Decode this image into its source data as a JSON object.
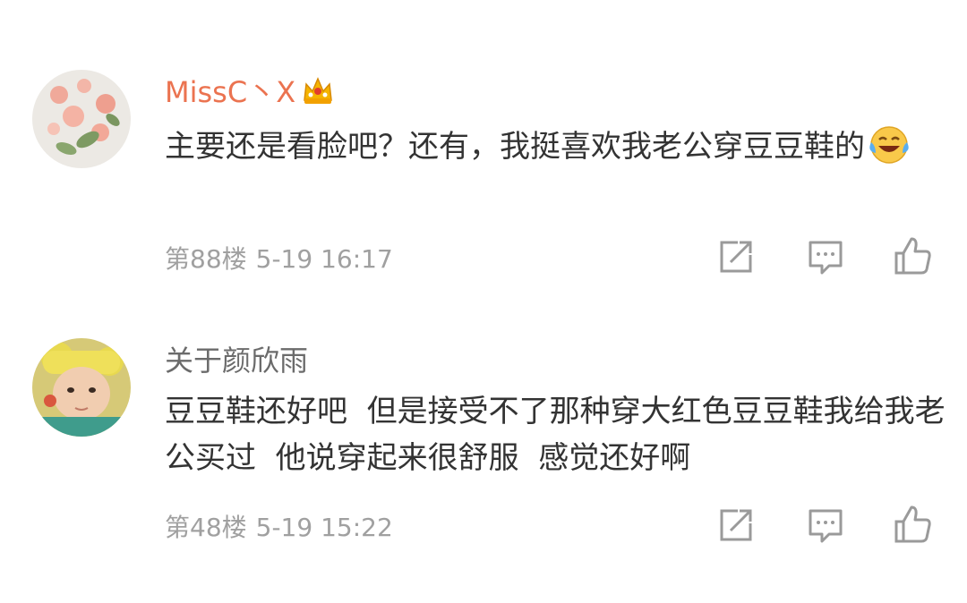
{
  "comments": [
    {
      "username": "MissC丶X",
      "text": "主要还是看脸吧？还有，我挺喜欢我老公穿豆豆鞋的",
      "floor": "第88楼",
      "time": "5-19 16:17",
      "badge_icon": "crown-icon",
      "emoji_icon": "laugh-cry-emoji-icon"
    },
    {
      "username": "关于颜欣雨",
      "text": "豆豆鞋还好吧  但是接受不了那种穿大红色豆豆鞋我给我老公买过  他说穿起来很舒服  感觉还好啊",
      "floor": "第48楼",
      "time": "5-19 15:22"
    }
  ],
  "colors": {
    "vip_name": "#eb7350",
    "normal_name": "#6b6b6b",
    "body_text": "#333333",
    "meta_text": "#a0a0a0",
    "icon": "#9a9a9a"
  },
  "action_icons": [
    "repost-icon",
    "comment-icon",
    "like-icon"
  ]
}
